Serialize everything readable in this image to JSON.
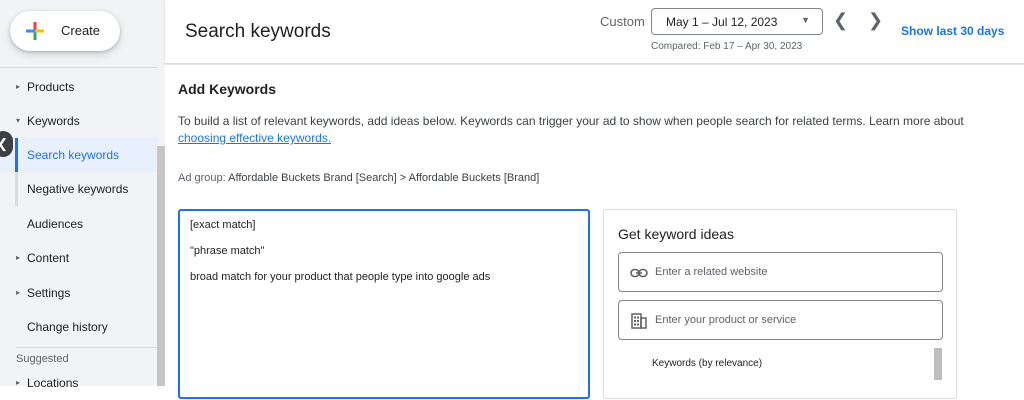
{
  "sidebar": {
    "create_label": "Create",
    "items": [
      {
        "label": "Products",
        "caret": "▸"
      },
      {
        "label": "Keywords",
        "caret": "▾"
      },
      {
        "label": "Search keywords"
      },
      {
        "label": "Negative keywords"
      },
      {
        "label": "Audiences"
      },
      {
        "label": "Content",
        "caret": "▸"
      },
      {
        "label": "Settings",
        "caret": "▸"
      },
      {
        "label": "Change history"
      }
    ],
    "suggested_label": "Suggested",
    "suggested_items": [
      {
        "label": "Locations",
        "caret": "▸"
      }
    ]
  },
  "header": {
    "title": "Search keywords",
    "custom_label": "Custom",
    "date_range": "May 1 – Jul 12, 2023",
    "compared": "Compared: Feb 17 – Apr 30, 2023",
    "show_last": "Show last 30 days"
  },
  "main": {
    "section_title": "Add Keywords",
    "description": "To build a list of relevant keywords, add ideas below. Keywords can trigger your ad to show when people search for related terms. Learn more about ",
    "description_link": "choosing effective keywords.",
    "ad_group_label": "Ad group:",
    "ad_group_value": "Affordable Buckets Brand [Search] > Affordable Buckets [Brand]",
    "keywords_lines": [
      "[exact match]",
      "\"phrase match\"",
      "broad match for your product that people type into google ads"
    ]
  },
  "ideas": {
    "title": "Get keyword ideas",
    "website_placeholder": "Enter a related website",
    "product_placeholder": "Enter your product or service",
    "sort_label": "Keywords (by relevance)"
  },
  "colors": {
    "accent": "#1a73e8",
    "sidebar_bg": "#f1f3f4",
    "active_bg": "#e8f0fe"
  }
}
